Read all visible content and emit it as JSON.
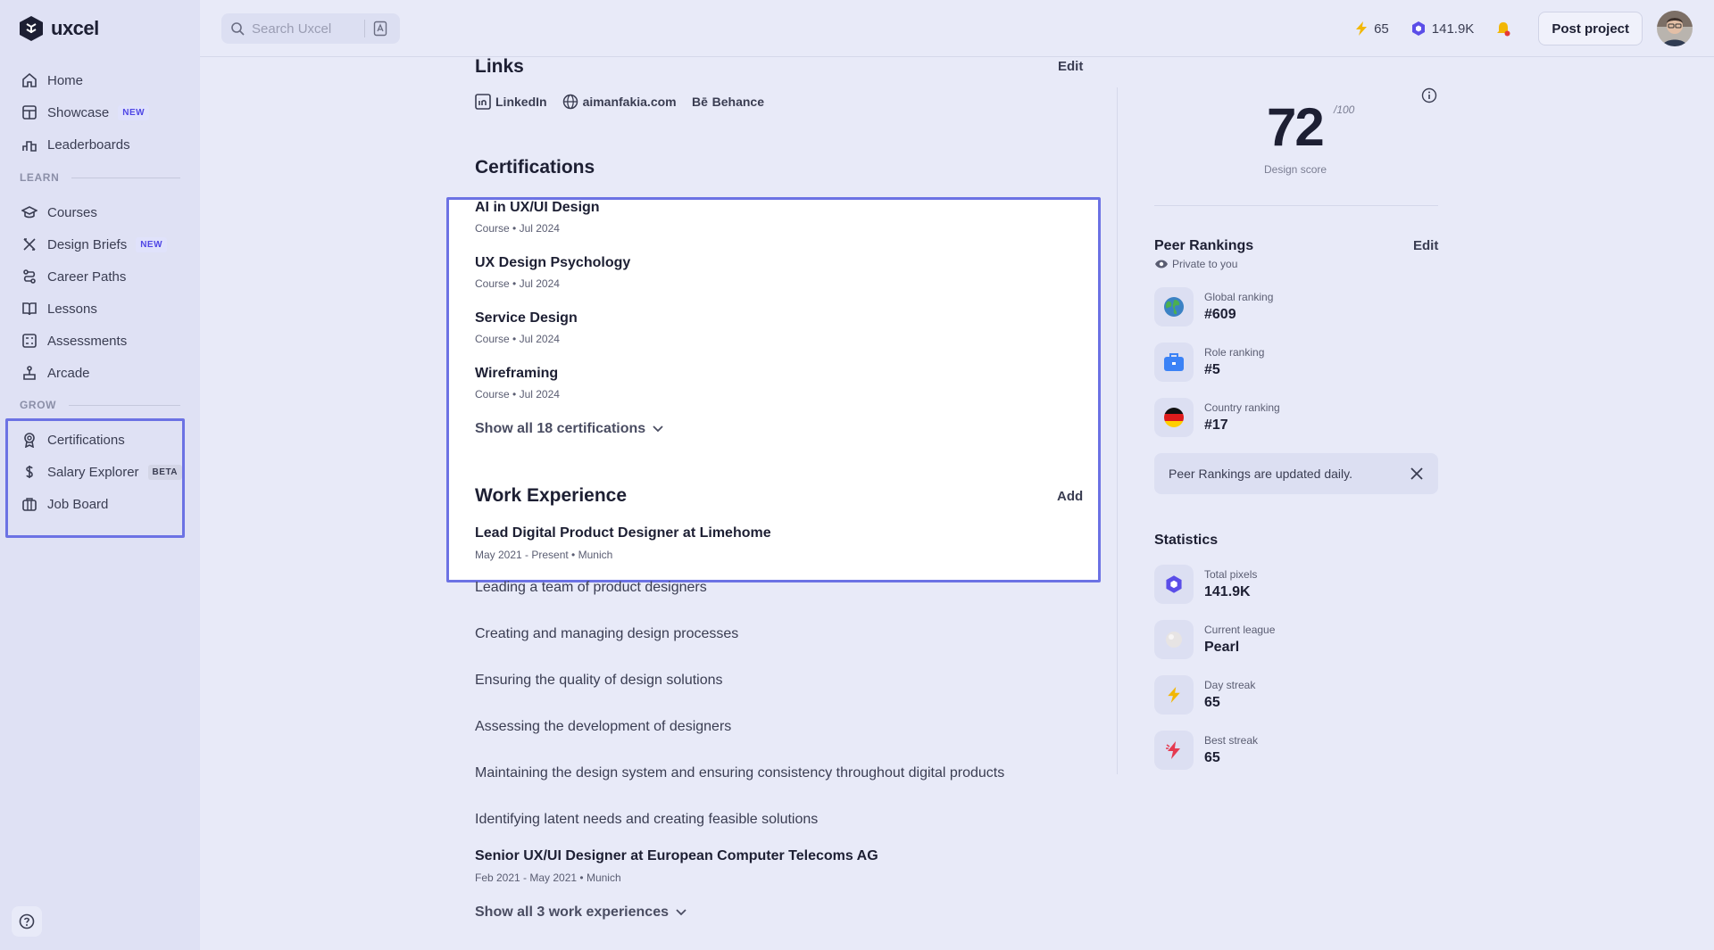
{
  "app": {
    "name": "uxcel"
  },
  "colors": {
    "accent": "#6c72e4",
    "brand": "#4f46e5",
    "streak": "#f2b705",
    "alert_dot": "#e53935"
  },
  "sidebar": {
    "main_items": [
      {
        "label": "Home",
        "icon": "home-icon"
      },
      {
        "label": "Showcase",
        "icon": "showcase-icon",
        "badge": "NEW"
      },
      {
        "label": "Leaderboards",
        "icon": "leaderboards-icon"
      }
    ],
    "learn_label": "LEARN",
    "learn_items": [
      {
        "label": "Courses",
        "icon": "graduation-cap-icon"
      },
      {
        "label": "Design Briefs",
        "icon": "design-briefs-icon",
        "badge": "NEW"
      },
      {
        "label": "Career Paths",
        "icon": "career-paths-icon"
      },
      {
        "label": "Lessons",
        "icon": "book-icon"
      },
      {
        "label": "Assessments",
        "icon": "assessments-icon"
      },
      {
        "label": "Arcade",
        "icon": "arcade-icon"
      }
    ],
    "grow_label": "GROW",
    "grow_items": [
      {
        "label": "Certifications",
        "icon": "certificate-icon"
      },
      {
        "label": "Salary Explorer",
        "icon": "dollar-icon",
        "badge": "BETA"
      },
      {
        "label": "Job Board",
        "icon": "briefcase-icon"
      }
    ]
  },
  "topbar": {
    "search_placeholder": "Search Uxcel",
    "streak": "65",
    "pixels": "141.9K",
    "post_button": "Post project"
  },
  "links": {
    "title": "Links",
    "edit": "Edit",
    "items": [
      {
        "label": "LinkedIn",
        "icon": "linkedin-icon"
      },
      {
        "label": "aimanfakia.com",
        "icon": "globe-icon"
      },
      {
        "label": "Behance",
        "icon": "behance-icon"
      }
    ]
  },
  "certifications": {
    "title": "Certifications",
    "items": [
      {
        "title": "AI in UX/UI Design",
        "type": "Course",
        "date": "Jul 2024"
      },
      {
        "title": "UX Design Psychology",
        "type": "Course",
        "date": "Jul 2024"
      },
      {
        "title": "Service Design",
        "type": "Course",
        "date": "Jul 2024"
      },
      {
        "title": "Wireframing",
        "type": "Course",
        "date": "Jul 2024"
      }
    ],
    "show_all": "Show all 18 certifications"
  },
  "work": {
    "title": "Work Experience",
    "add": "Add",
    "jobs": [
      {
        "title": "Lead Digital Product Designer at Limehome",
        "period": "May 2021 - Present",
        "location": "Munich"
      },
      {
        "title": "Senior UX/UI Designer at European Computer Telecoms AG",
        "period": "Feb 2021 - May 2021",
        "location": "Munich"
      }
    ],
    "bullets": [
      "Leading a team of product designers",
      "Creating and managing design processes",
      "Ensuring the quality of design solutions",
      "Assessing the development of designers",
      "Maintaining the design system and ensuring consistency throughout digital products",
      "Identifying latent needs and creating feasible solutions"
    ],
    "show_all": "Show all 3 work experiences"
  },
  "score": {
    "value": "72",
    "max": "/100",
    "label": "Design score"
  },
  "peer_rankings": {
    "title": "Peer Rankings",
    "edit": "Edit",
    "privacy": "Private to you",
    "items": [
      {
        "label": "Global ranking",
        "value": "#609",
        "icon": "globe-earth-icon"
      },
      {
        "label": "Role ranking",
        "value": "#5",
        "icon": "briefcase-icon"
      },
      {
        "label": "Country ranking",
        "value": "#17",
        "icon": "germany-flag-icon"
      }
    ],
    "notice": "Peer Rankings are updated daily."
  },
  "statistics": {
    "title": "Statistics",
    "items": [
      {
        "label": "Total pixels",
        "value": "141.9K",
        "icon": "pixel-hexagon-icon"
      },
      {
        "label": "Current league",
        "value": "Pearl",
        "icon": "pearl-icon"
      },
      {
        "label": "Day streak",
        "value": "65",
        "icon": "lightning-icon"
      },
      {
        "label": "Best streak",
        "value": "65",
        "icon": "best-streak-icon"
      }
    ]
  }
}
